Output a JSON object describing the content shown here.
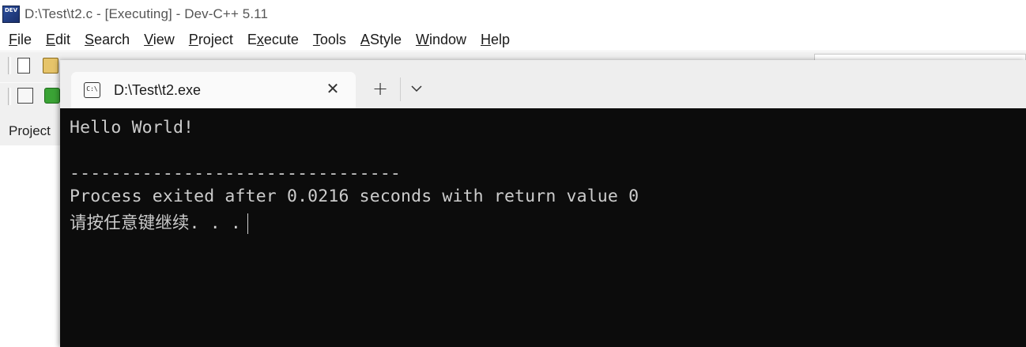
{
  "window": {
    "title": "D:\\Test\\t2.c - [Executing] - Dev-C++ 5.11",
    "icon_name": "devcpp-app-icon",
    "icon_text": "DEV"
  },
  "menubar": {
    "items": [
      {
        "label": "File",
        "accel": "F",
        "rest": "ile"
      },
      {
        "label": "Edit",
        "accel": "E",
        "rest": "dit"
      },
      {
        "label": "Search",
        "accel": "S",
        "rest": "earch"
      },
      {
        "label": "View",
        "accel": "V",
        "rest": "iew"
      },
      {
        "label": "Project",
        "accel": "P",
        "rest": "roject"
      },
      {
        "label": "Execute",
        "pre": "E",
        "accel": "x",
        "rest": "ecute"
      },
      {
        "label": "Tools",
        "accel": "T",
        "rest": "ools"
      },
      {
        "label": "AStyle",
        "accel": "A",
        "rest": "Style"
      },
      {
        "label": "Window",
        "accel": "W",
        "rest": "indow"
      },
      {
        "label": "Help",
        "accel": "H",
        "rest": "elp"
      }
    ]
  },
  "left_panel": {
    "tab_label": "Project"
  },
  "terminal": {
    "tab": {
      "title": "D:\\Test\\t2.exe",
      "icon_name": "command-prompt-icon",
      "icon_text": "C:\\",
      "close_glyph": "✕"
    },
    "new_tab_glyph": "+",
    "lines": [
      "Hello World!",
      "",
      "--------------------------------",
      "Process exited after 0.0216 seconds with return value 0",
      "请按任意键继续. . ."
    ]
  },
  "colors": {
    "terminal_bg": "#0c0c0c",
    "terminal_text": "#cccccc",
    "tabbar_bg": "#eeeeee",
    "app_bg": "#f0f0f0"
  }
}
